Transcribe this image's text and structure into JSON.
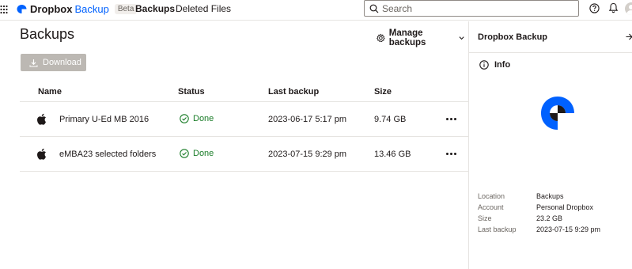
{
  "header": {
    "brand_name": "Dropbox",
    "brand_product": "Backup",
    "beta_badge": "Beta",
    "nav": [
      {
        "label": "Backups"
      },
      {
        "label": "Deleted Files"
      }
    ],
    "search_placeholder": "Search"
  },
  "main": {
    "title": "Backups",
    "manage_label": "Manage backups",
    "download_label": "Download",
    "columns": [
      "Name",
      "Status",
      "Last backup",
      "Size"
    ],
    "rows": [
      {
        "icon": "apple-icon",
        "name": "Primary U-Ed MB 2016",
        "status": "Done",
        "last_backup": "2023-06-17 5:17 pm",
        "size": "9.74 GB"
      },
      {
        "icon": "apple-icon",
        "name": "eMBA23 selected folders",
        "status": "Done",
        "last_backup": "2023-07-15 9:29 pm",
        "size": "13.46 GB"
      }
    ]
  },
  "side_panel": {
    "title": "Dropbox Backup",
    "info_label": "Info",
    "details": [
      {
        "label": "Location",
        "value": "Backups"
      },
      {
        "label": "Account",
        "value": "Personal Dropbox"
      },
      {
        "label": "Size",
        "value": "23.2 GB"
      },
      {
        "label": "Last backup",
        "value": "2023-07-15 9:29 pm"
      }
    ]
  },
  "colors": {
    "accent": "#0061fe",
    "success": "#1b7d29",
    "disabled_button": "#bcb8b3"
  }
}
